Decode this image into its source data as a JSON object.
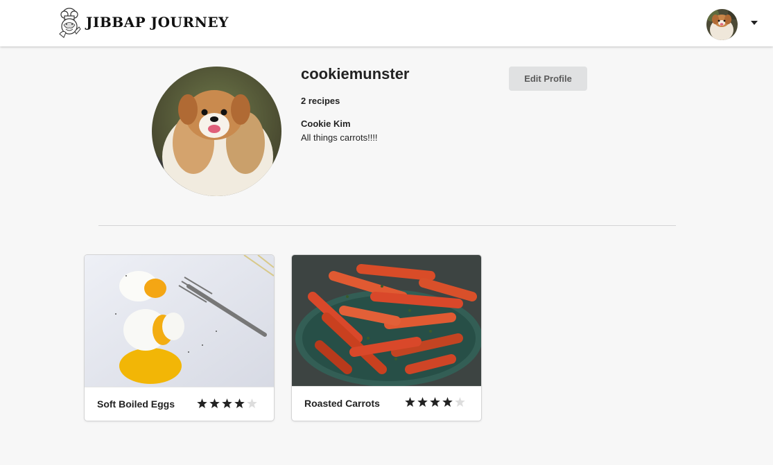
{
  "header": {
    "brand_name": "JIBBAP JOURNEY",
    "logo_icon": "chef-icon",
    "avatar_icon": "user-avatar",
    "menu_icon": "caret-down-icon"
  },
  "profile": {
    "username": "cookiemunster",
    "recipe_count": "2 recipes",
    "full_name": "Cookie Kim",
    "bio": "All things carrots!!!!",
    "edit_label": "Edit Profile"
  },
  "recipes": [
    {
      "title": "Soft Boiled Eggs",
      "rating": 4,
      "max_rating": 5
    },
    {
      "title": "Roasted Carrots",
      "rating": 4,
      "max_rating": 5
    }
  ],
  "colors": {
    "page_bg": "#f7f7f7",
    "star_filled": "#222222",
    "star_empty": "#dddddd",
    "button_bg": "#e0e1e2"
  }
}
